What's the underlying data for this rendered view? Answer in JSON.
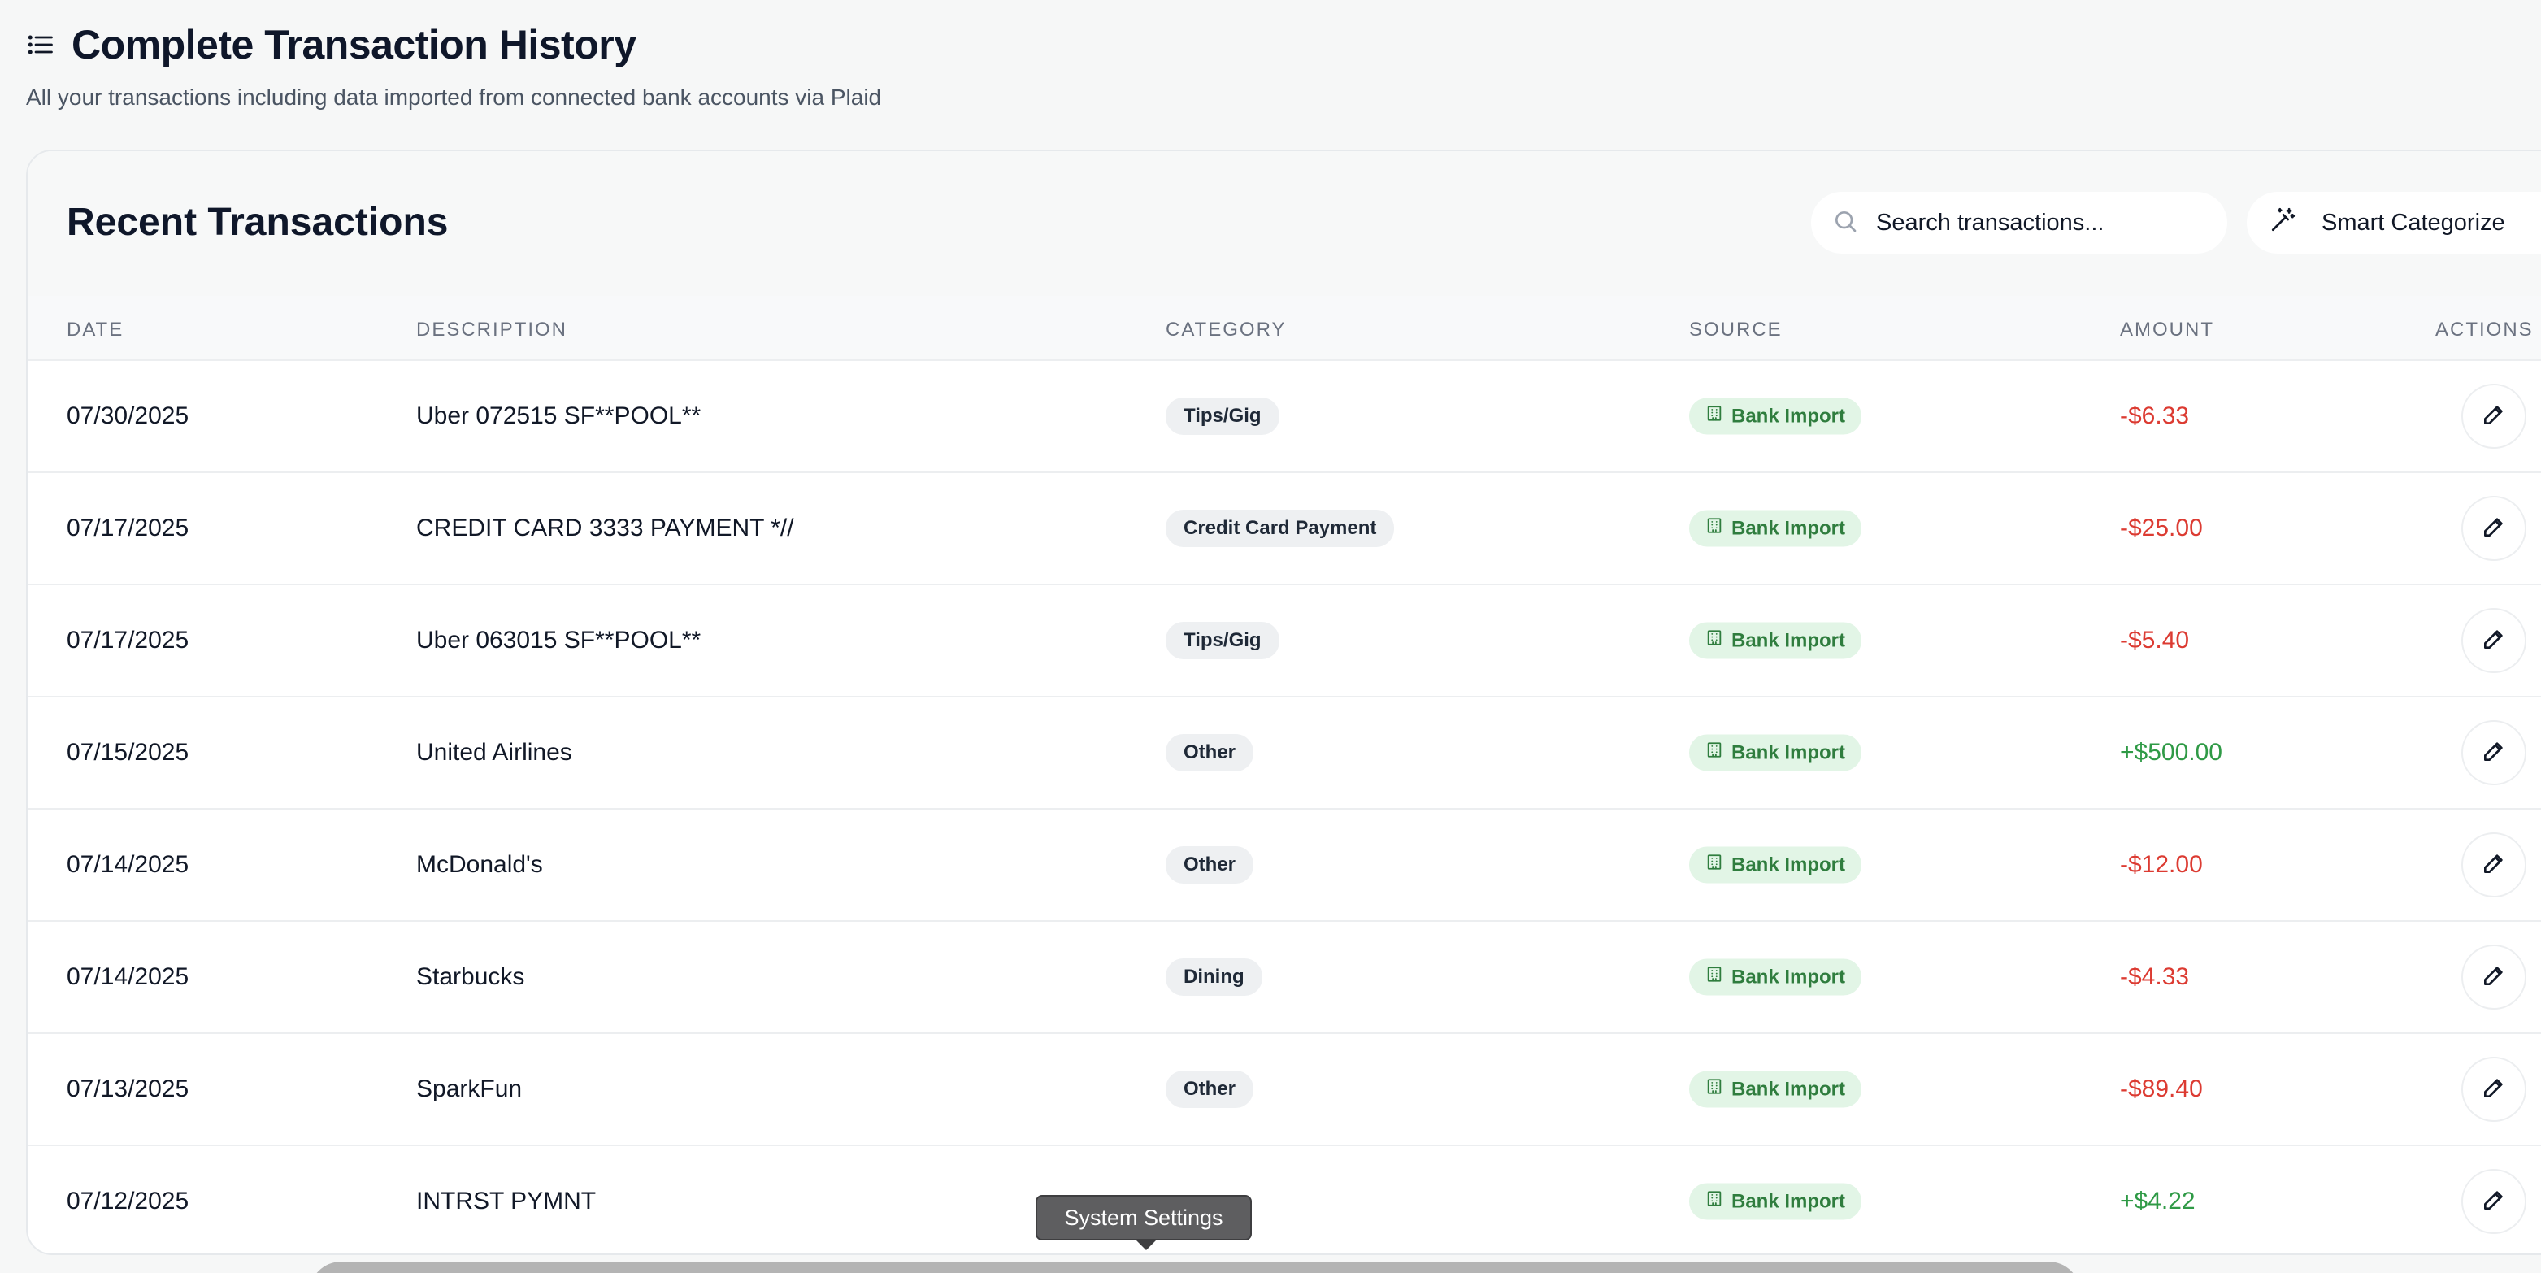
{
  "page": {
    "title": "Complete Transaction History",
    "subtitle": "All your transactions including data imported from connected bank accounts via Plaid"
  },
  "card": {
    "title": "Recent Transactions",
    "search_placeholder": "Search transactions...",
    "smart_button": "Smart Categorize"
  },
  "columns": {
    "date": "DATE",
    "description": "DESCRIPTION",
    "category": "CATEGORY",
    "source": "SOURCE",
    "amount": "AMOUNT",
    "actions": "ACTIONS"
  },
  "transactions": [
    {
      "date": "07/30/2025",
      "description": "Uber 072515 SF**POOL**",
      "category": "Tips/Gig",
      "source": "Bank Import",
      "amount": "-$6.33",
      "sign": "neg"
    },
    {
      "date": "07/17/2025",
      "description": "CREDIT CARD 3333 PAYMENT *//",
      "category": "Credit Card Payment",
      "source": "Bank Import",
      "amount": "-$25.00",
      "sign": "neg"
    },
    {
      "date": "07/17/2025",
      "description": "Uber 063015 SF**POOL**",
      "category": "Tips/Gig",
      "source": "Bank Import",
      "amount": "-$5.40",
      "sign": "neg"
    },
    {
      "date": "07/15/2025",
      "description": "United Airlines",
      "category": "Other",
      "source": "Bank Import",
      "amount": "+$500.00",
      "sign": "pos"
    },
    {
      "date": "07/14/2025",
      "description": "McDonald's",
      "category": "Other",
      "source": "Bank Import",
      "amount": "-$12.00",
      "sign": "neg"
    },
    {
      "date": "07/14/2025",
      "description": "Starbucks",
      "category": "Dining",
      "source": "Bank Import",
      "amount": "-$4.33",
      "sign": "neg"
    },
    {
      "date": "07/13/2025",
      "description": "SparkFun",
      "category": "Other",
      "source": "Bank Import",
      "amount": "-$89.40",
      "sign": "neg"
    },
    {
      "date": "07/12/2025",
      "description": "INTRST PYMNT",
      "category": "",
      "source": "Bank Import",
      "amount": "+$4.22",
      "sign": "pos"
    }
  ],
  "tooltip": {
    "text": "System Settings"
  },
  "colors": {
    "negative": "#dc3b32",
    "positive": "#2f9a46",
    "source_badge_bg": "#e2f5e6",
    "source_badge_text": "#2f7d3e",
    "category_badge_bg": "#eef0f2"
  },
  "icons": {
    "header": "list-icon",
    "search": "search-icon",
    "smart": "magic-wand-icon",
    "source": "bank-building-icon",
    "edit": "pencil-icon"
  }
}
